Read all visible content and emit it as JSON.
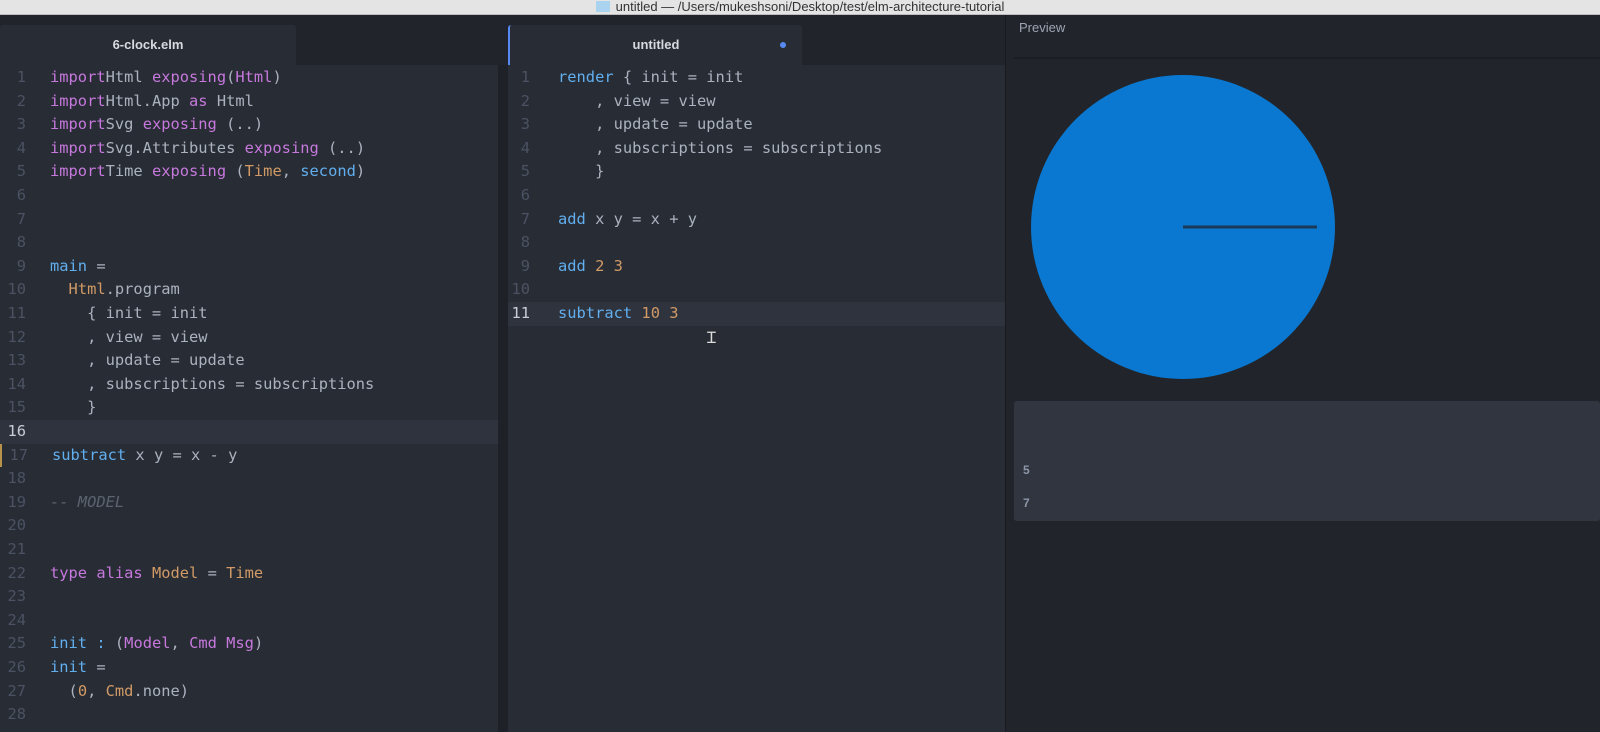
{
  "window": {
    "title": "untitled — /Users/mukeshsoni/Desktop/test/elm-architecture-tutorial"
  },
  "left_pane": {
    "tab": "6-clock.elm",
    "current_line": 16,
    "lines": [
      [
        [
          "kw",
          "import"
        ],
        [
          "",
          "Html "
        ],
        [
          "kw",
          "exposing"
        ],
        [
          "",
          ""
        ],
        [
          "",
          "("
        ],
        [
          "kw",
          "Html"
        ],
        [
          "",
          ")"
        ]
      ],
      [
        [
          "kw",
          "import"
        ],
        [
          "",
          "Html.App "
        ],
        [
          "kw",
          "as"
        ],
        [
          "",
          " Html"
        ]
      ],
      [
        [
          "kw",
          "import"
        ],
        [
          "",
          "Svg "
        ],
        [
          "kw",
          "exposing"
        ],
        [
          "",
          " (..)"
        ]
      ],
      [
        [
          "kw",
          "import"
        ],
        [
          "",
          "Svg.Attributes "
        ],
        [
          "kw",
          "exposing"
        ],
        [
          "",
          " (..)"
        ]
      ],
      [
        [
          "kw",
          "import"
        ],
        [
          "",
          "Time "
        ],
        [
          "kw",
          "exposing"
        ],
        [
          "",
          " ("
        ],
        [
          "ty",
          "Time"
        ],
        [
          "",
          ", "
        ],
        [
          "fn",
          "second"
        ],
        [
          "",
          ")"
        ]
      ],
      [],
      [],
      [],
      [
        [
          "fn",
          "main"
        ],
        [
          "",
          " ="
        ]
      ],
      [
        [
          "",
          "  "
        ],
        [
          "ty",
          "Html"
        ],
        [
          "",
          ".program"
        ]
      ],
      [
        [
          "",
          "    { init = init"
        ]
      ],
      [
        [
          "",
          "    , view = view"
        ]
      ],
      [
        [
          "",
          "    , update = update"
        ]
      ],
      [
        [
          "",
          "    , subscriptions = subscriptions"
        ]
      ],
      [
        [
          "",
          "    }"
        ]
      ],
      [],
      [
        [
          "fn",
          "subtract"
        ],
        [
          "",
          " x y = x - y"
        ]
      ],
      [],
      [
        [
          "cm",
          "-- MODEL"
        ]
      ],
      [],
      [],
      [
        [
          "kw",
          "type alias"
        ],
        [
          "",
          " "
        ],
        [
          "ty",
          "Model"
        ],
        [
          "",
          " = "
        ],
        [
          "ty",
          "Time"
        ]
      ],
      [],
      [],
      [
        [
          "fn",
          "init"
        ],
        [
          "fn",
          " :"
        ],
        [
          "",
          " ("
        ],
        [
          "kw",
          "Model"
        ],
        [
          "",
          ", "
        ],
        [
          "kw",
          "Cmd Msg"
        ],
        [
          "",
          ")"
        ]
      ],
      [
        [
          "fn",
          "init"
        ],
        [
          "",
          " ="
        ]
      ],
      [
        [
          "",
          "  ("
        ],
        [
          "num",
          "0"
        ],
        [
          "",
          ", "
        ],
        [
          "ty",
          "Cmd"
        ],
        [
          "",
          ".none)"
        ]
      ],
      []
    ]
  },
  "middle_pane": {
    "tab": "untitled",
    "modified": true,
    "current_line": 11,
    "lines": [
      [
        [
          "fn",
          "render"
        ],
        [
          "",
          " { init = init"
        ]
      ],
      [
        [
          "",
          "    , view = view"
        ]
      ],
      [
        [
          "",
          "    , update = update"
        ]
      ],
      [
        [
          "",
          "    , subscriptions = subscriptions"
        ]
      ],
      [
        [
          "",
          "    }"
        ]
      ],
      [],
      [
        [
          "fn",
          "add"
        ],
        [
          "",
          " x y = x + y"
        ]
      ],
      [],
      [
        [
          "fn",
          "add"
        ],
        [
          "",
          " "
        ],
        [
          "num",
          "2 3"
        ]
      ],
      [],
      [
        [
          "fn",
          "subtract"
        ],
        [
          "",
          " "
        ],
        [
          "num",
          "10 3"
        ]
      ]
    ]
  },
  "preview": {
    "label": "Preview",
    "clock_color": "#0a78d0",
    "hand_color": "#1b3a57",
    "outputs": [
      "5",
      "7"
    ]
  }
}
